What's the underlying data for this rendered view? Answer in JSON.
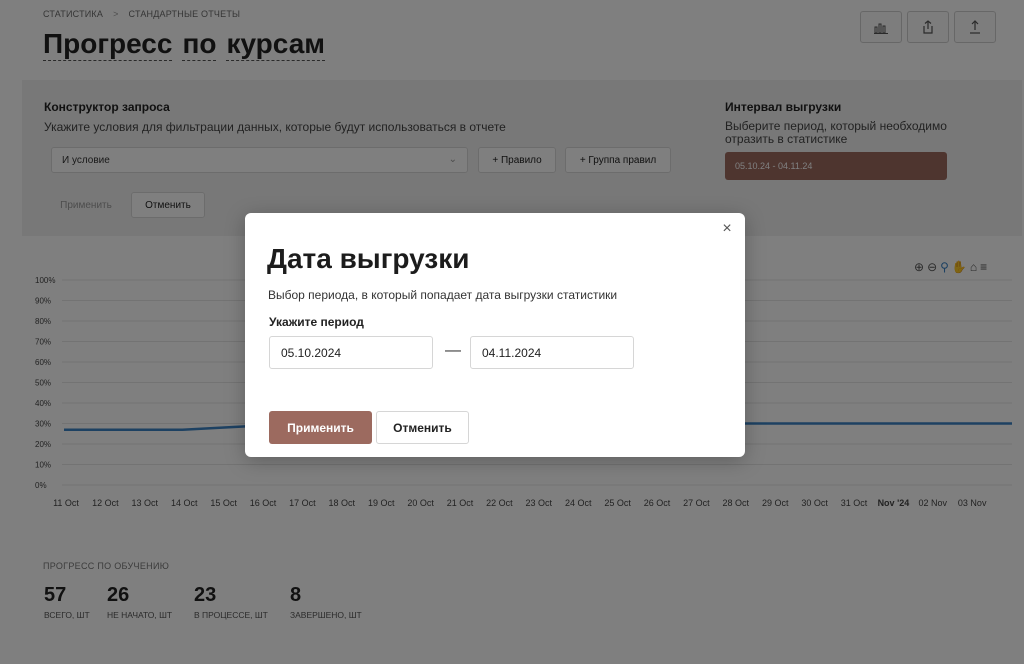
{
  "breadcrumb": {
    "items": [
      "СТАТИСТИКА",
      "СТАНДАРТНЫЕ ОТЧЕТЫ"
    ],
    "separator": ">"
  },
  "page": {
    "title_words": [
      "Прогресс",
      "по",
      "курсам"
    ]
  },
  "top_actions": [
    "chart-icon",
    "share-icon",
    "upload-icon"
  ],
  "query": {
    "title": "Конструктор запроса",
    "description": "Укажите условия для фильтрации данных, которые будут использоваться в отчете",
    "condition_select": "И условие",
    "add_rule": "+ Правило",
    "add_group": "+ Группа правил",
    "apply": "Применить",
    "cancel": "Отменить"
  },
  "interval": {
    "title": "Интервал выгрузки",
    "description": "Выберите период, который необходимо отразить в статистике",
    "value": "05.10.24 - 04.11.24"
  },
  "chart_tools": [
    "zoom-in-icon",
    "zoom-out-icon",
    "zoom-select-icon",
    "pan-icon",
    "home-icon",
    "menu-icon"
  ],
  "chart_data": {
    "type": "line",
    "categories": [
      "11 Oct",
      "12 Oct",
      "13 Oct",
      "14 Oct",
      "15 Oct",
      "16 Oct",
      "17 Oct",
      "18 Oct",
      "19 Oct",
      "20 Oct",
      "21 Oct",
      "22 Oct",
      "23 Oct",
      "24 Oct",
      "25 Oct",
      "26 Oct",
      "27 Oct",
      "28 Oct",
      "29 Oct",
      "30 Oct",
      "31 Oct",
      "Nov '24",
      "02 Nov",
      "03 Nov"
    ],
    "bold_categories": [
      "Nov '24"
    ],
    "y_ticks": [
      "0%",
      "10%",
      "20%",
      "30%",
      "40%",
      "50%",
      "60%",
      "70%",
      "80%",
      "90%",
      "100%"
    ],
    "ylim": [
      0,
      100
    ],
    "series": [
      {
        "values": [
          27,
          27,
          27,
          27,
          28,
          29,
          29,
          29,
          29,
          29,
          29,
          29,
          29,
          29,
          29,
          29,
          29,
          30,
          30,
          30,
          30,
          30,
          30,
          30,
          30
        ],
        "color": "#3b82c4"
      }
    ],
    "grid": true
  },
  "stats": {
    "title": "ПРОГРЕСС ПО ОБУЧЕНИЮ",
    "items": [
      {
        "value": "57",
        "label": "ВСЕГО, ШТ"
      },
      {
        "value": "26",
        "label": "НЕ НАЧАТО, ШТ"
      },
      {
        "value": "23",
        "label": "В ПРОЦЕССЕ, ШТ"
      },
      {
        "value": "8",
        "label": "ЗАВЕРШЕНО, ШТ"
      }
    ]
  },
  "modal": {
    "title": "Дата выгрузки",
    "description": "Выбор периода, в который попадает дата выгрузки статистики",
    "label": "Укажите период",
    "date_from": "05.10.2024",
    "date_to": "04.11.2024",
    "dash": "—",
    "close": "×",
    "apply": "Применить",
    "cancel": "Отменить"
  },
  "colors": {
    "accent": "#9c6a5f",
    "series": "#3b82c4"
  }
}
